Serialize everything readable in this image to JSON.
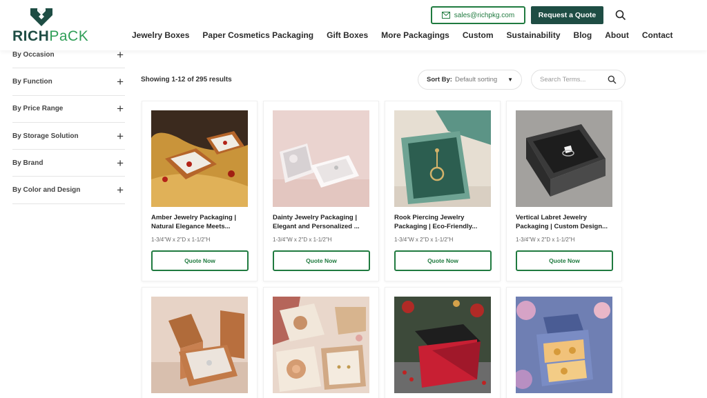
{
  "header": {
    "logo": {
      "rich": "RICH",
      "pack": "PaCK"
    },
    "nav": [
      "Jewelry Boxes",
      "Paper Cosmetics Packaging",
      "Gift Boxes",
      "More Packagings",
      "Custom",
      "Sustainability",
      "Blog",
      "About",
      "Contact"
    ],
    "email": "sales@richpkg.com",
    "quote_button": "Request a Quote",
    "brand_color": "#1e4d44",
    "accent_color": "#1f7a3f"
  },
  "sidebar": {
    "filters": [
      "By Occasion",
      "By Function",
      "By Price Range",
      "By Storage Solution",
      "By Brand",
      "By Color and Design"
    ],
    "expand_symbol": "+"
  },
  "toolbar": {
    "results_text": "Showing 1-12 of 295 results",
    "sort_label": "Sort By:",
    "sort_value": "Default sorting",
    "search_placeholder": "Search Terms..."
  },
  "products": [
    {
      "title": "Amber Jewelry Packaging | Natural Elegance Meets...",
      "dimensions": "1-3/4\"W x 2\"D x 1-1/2\"H",
      "button": "Quote Now"
    },
    {
      "title": "Dainty Jewelry Packaging | Elegant and Personalized ...",
      "dimensions": "1-3/4\"W x 2\"D x 1-1/2\"H",
      "button": "Quote Now"
    },
    {
      "title": "Rook Piercing Jewelry Packaging | Eco-Friendly...",
      "dimensions": "1-3/4\"W x 2\"D x 1-1/2\"H",
      "button": "Quote Now"
    },
    {
      "title": "Vertical Labret Jewelry Packaging | Custom Design...",
      "dimensions": "1-3/4\"W x 2\"D x 1-1/2\"H",
      "button": "Quote Now"
    },
    {
      "title": "",
      "dimensions": "",
      "button": ""
    },
    {
      "title": "",
      "dimensions": "",
      "button": ""
    },
    {
      "title": "",
      "dimensions": "",
      "button": ""
    },
    {
      "title": "",
      "dimensions": "",
      "button": ""
    }
  ]
}
